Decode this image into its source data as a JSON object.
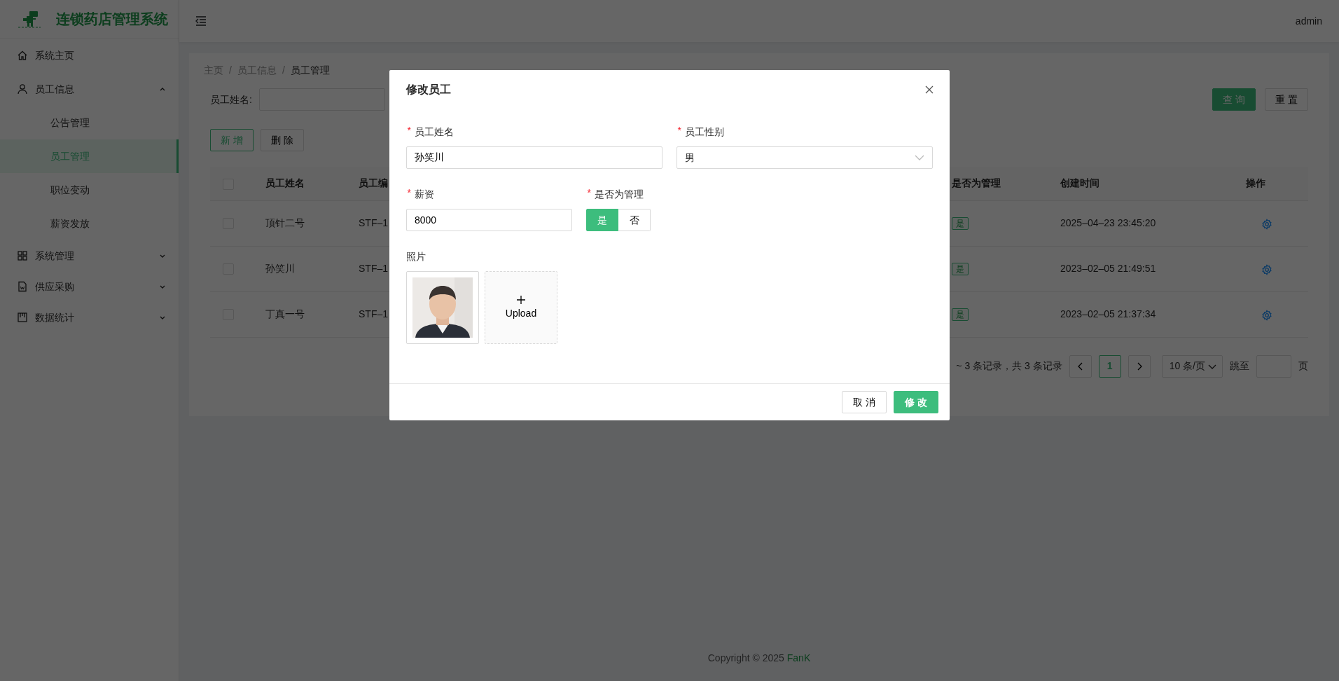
{
  "app": {
    "title": "连锁药店管理系统",
    "user": "admin"
  },
  "sidebar": {
    "items": [
      {
        "label": "系统主页",
        "kind": "home",
        "selected": false
      },
      {
        "label": "员工信息",
        "kind": "user",
        "selected": false,
        "expanded": true,
        "children": [
          {
            "label": "公告管理",
            "selected": false
          },
          {
            "label": "员工管理",
            "selected": true
          },
          {
            "label": "职位变动",
            "selected": false
          },
          {
            "label": "薪资发放",
            "selected": false
          }
        ]
      },
      {
        "label": "系统管理",
        "kind": "grid",
        "selected": false,
        "expanded": false
      },
      {
        "label": "供应采购",
        "kind": "file",
        "selected": false,
        "expanded": false
      },
      {
        "label": "数据统计",
        "kind": "chart",
        "selected": false,
        "expanded": false
      }
    ]
  },
  "breadcrumb": [
    {
      "kind": "item",
      "label": "主页"
    },
    {
      "kind": "separator",
      "label": "/"
    },
    {
      "kind": "item",
      "label": "员工信息"
    },
    {
      "kind": "separator",
      "label": "/"
    },
    {
      "kind": "current",
      "label": "员工管理"
    }
  ],
  "search": {
    "label": "员工姓名:",
    "buttons": [
      {
        "label": "查 询",
        "primary": true
      },
      {
        "label": "重 置",
        "primary": false
      }
    ]
  },
  "actions": [
    {
      "label": "新 增",
      "kind": "add"
    },
    {
      "label": "删 除",
      "kind": "delete"
    }
  ],
  "table": {
    "header_checked": false,
    "columns": [
      "员工姓名",
      "员工编",
      "是否为管理",
      "创建时间",
      "操作"
    ],
    "rows": [
      {
        "checked": false,
        "name": "顶针二号",
        "code": "STF–1",
        "admin": "是",
        "created": "2025–04–23 23:45:20"
      },
      {
        "checked": false,
        "name": "孙笑川",
        "code": "STF–1",
        "admin": "是",
        "created": "2023–02–05 21:49:51"
      },
      {
        "checked": false,
        "name": "丁真一号",
        "code": "STF–1",
        "admin": "是",
        "created": "2023–02–05 21:37:34"
      }
    ]
  },
  "pagination": {
    "summary": "~ 3 条记录，共 3 条记录",
    "pages": [
      {
        "label": "1",
        "selected": true
      }
    ],
    "page_size": "10 条/页",
    "jump_label": "跳至",
    "page_suffix": "页"
  },
  "footer": {
    "text": "Copyright © 2025",
    "author": "FanK"
  },
  "modal": {
    "title": "修改员工",
    "fields": [
      {
        "kind": "text",
        "label": "员工姓名",
        "required_mark": "*",
        "value": "孙笑川"
      },
      {
        "kind": "select",
        "label": "员工性别",
        "required_mark": "*",
        "value": "男"
      },
      {
        "kind": "text",
        "label": "薪资",
        "required_mark": "*",
        "value": "8000"
      },
      {
        "kind": "toggle",
        "label": "是否为管理",
        "required_mark": "*",
        "options": [
          {
            "label": "是",
            "selected": true
          },
          {
            "label": "否",
            "selected": false
          }
        ]
      },
      {
        "kind": "upload",
        "label": "照片",
        "upload_label": "Upload"
      }
    ],
    "buttons": [
      {
        "label": "取 消",
        "primary": false
      },
      {
        "label": "修 改",
        "primary": true
      }
    ]
  }
}
